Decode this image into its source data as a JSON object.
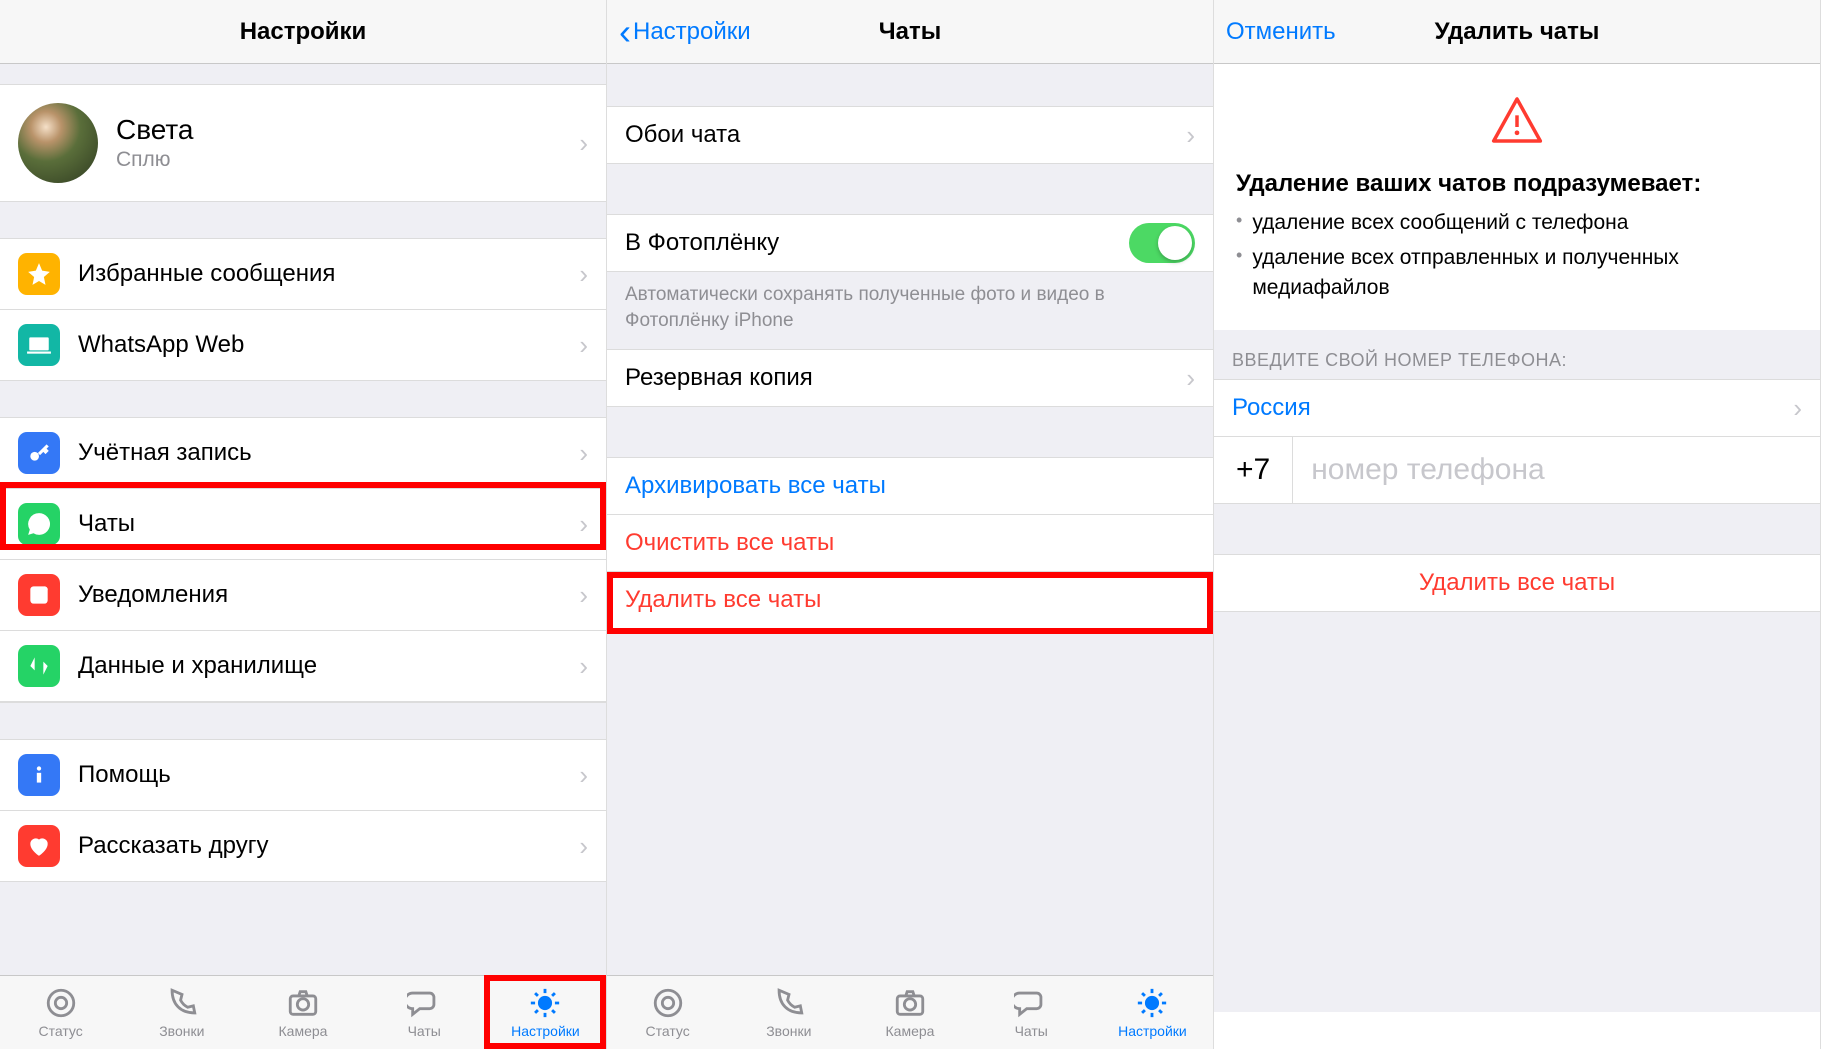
{
  "screen1": {
    "title": "Настройки",
    "profile": {
      "name": "Света",
      "status": "Сплю"
    },
    "rows": {
      "starred": "Избранные сообщения",
      "web": "WhatsApp Web",
      "account": "Учётная запись",
      "chats": "Чаты",
      "notifications": "Уведомления",
      "data": "Данные и хранилище",
      "help": "Помощь",
      "tell": "Рассказать другу"
    }
  },
  "screen2": {
    "back": "Настройки",
    "title": "Чаты",
    "wallpaper": "Обои чата",
    "cameraroll": "В Фотоплёнку",
    "cameraroll_footer": "Автоматически сохранять полученные фото и видео в Фотоплёнку iPhone",
    "backup": "Резервная копия",
    "archive": "Архивировать все чаты",
    "clear": "Очистить все чаты",
    "delete": "Удалить все чаты"
  },
  "screen3": {
    "cancel": "Отменить",
    "title": "Удалить чаты",
    "heading": "Удаление ваших чатов подразумевает:",
    "bullet1": "удаление всех сообщений с телефона",
    "bullet2": "удаление всех отправленных и полученных медиафайлов",
    "phone_header": "ВВЕДИТЕ СВОЙ НОМЕР ТЕЛЕФОНА:",
    "country": "Россия",
    "code": "+7",
    "placeholder": "номер телефона",
    "delete_button": "Удалить все чаты"
  },
  "tabs": {
    "status": "Статус",
    "calls": "Звонки",
    "camera": "Камера",
    "chats": "Чаты",
    "settings": "Настройки"
  },
  "colors": {
    "star": "#ffb300",
    "web": "#12b7a5",
    "key": "#3478f6",
    "chats": "#25d366",
    "notif": "#ff3b30",
    "data": "#25d366",
    "help": "#3478f6",
    "heart": "#ff3b30"
  }
}
